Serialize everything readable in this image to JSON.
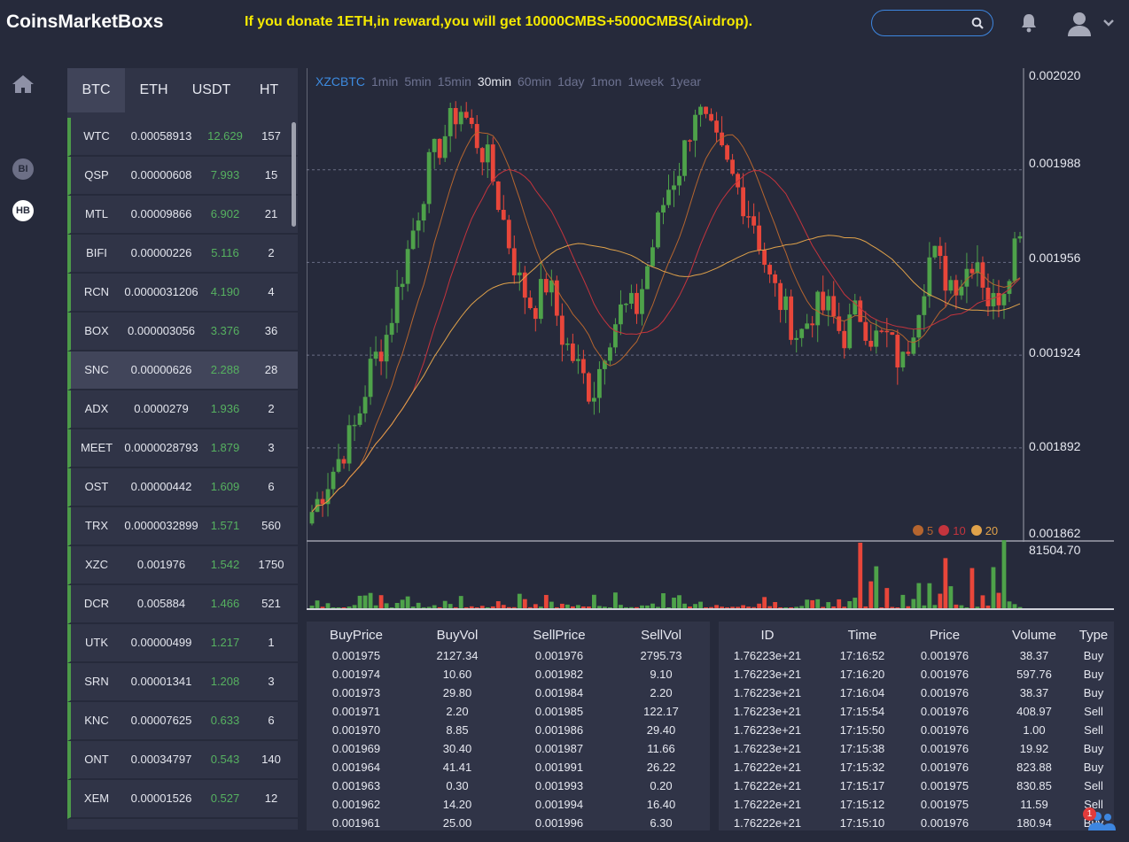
{
  "header": {
    "logo": "CoinsMarketBoxs",
    "promo": "If you donate 1ETH,in reward,you will get 10000CMBS+5000CMBS(Airdrop).",
    "search_placeholder": ""
  },
  "sidenav": {
    "items": [
      "home-icon",
      "BI",
      "HB"
    ]
  },
  "market_tabs": [
    "BTC",
    "ETH",
    "USDT",
    "HT"
  ],
  "active_market_tab": "BTC",
  "markets": [
    {
      "symbol": "WTC",
      "price": "0.00058913",
      "change": "12.629",
      "volume": "157"
    },
    {
      "symbol": "QSP",
      "price": "0.00000608",
      "change": "7.993",
      "volume": "15"
    },
    {
      "symbol": "MTL",
      "price": "0.00009866",
      "change": "6.902",
      "volume": "21"
    },
    {
      "symbol": "BIFI",
      "price": "0.00000226",
      "change": "5.116",
      "volume": "2"
    },
    {
      "symbol": "RCN",
      "price": "0.0000031206",
      "change": "4.190",
      "volume": "4"
    },
    {
      "symbol": "BOX",
      "price": "0.000003056",
      "change": "3.376",
      "volume": "36"
    },
    {
      "symbol": "SNC",
      "price": "0.00000626",
      "change": "2.288",
      "volume": "28"
    },
    {
      "symbol": "ADX",
      "price": "0.0000279",
      "change": "1.936",
      "volume": "2"
    },
    {
      "symbol": "MEET",
      "price": "0.0000028793",
      "change": "1.879",
      "volume": "3"
    },
    {
      "symbol": "OST",
      "price": "0.00000442",
      "change": "1.609",
      "volume": "6"
    },
    {
      "symbol": "TRX",
      "price": "0.0000032899",
      "change": "1.571",
      "volume": "560"
    },
    {
      "symbol": "XZC",
      "price": "0.001976",
      "change": "1.542",
      "volume": "1750"
    },
    {
      "symbol": "DCR",
      "price": "0.005884",
      "change": "1.466",
      "volume": "521"
    },
    {
      "symbol": "UTK",
      "price": "0.00000499",
      "change": "1.217",
      "volume": "1"
    },
    {
      "symbol": "SRN",
      "price": "0.00001341",
      "change": "1.208",
      "volume": "3"
    },
    {
      "symbol": "KNC",
      "price": "0.00007625",
      "change": "0.633",
      "volume": "6"
    },
    {
      "symbol": "ONT",
      "price": "0.00034797",
      "change": "0.543",
      "volume": "140"
    },
    {
      "symbol": "XEM",
      "price": "0.00001526",
      "change": "0.527",
      "volume": "12"
    }
  ],
  "selected_market": "SNC",
  "chart": {
    "symbol": "XZCBTC",
    "periods": [
      "1min",
      "5min",
      "15min",
      "30min",
      "60min",
      "1day",
      "1mon",
      "1week",
      "1year"
    ],
    "active_period": "30min",
    "y_ticks": [
      "0.002020",
      "0.001988",
      "0.001956",
      "0.001924",
      "0.001892",
      "0.001862"
    ],
    "volume_max": "81504.70",
    "ma_legend": [
      {
        "label": "5",
        "color": "#b5652f"
      },
      {
        "label": "10",
        "color": "#c4343d"
      },
      {
        "label": "20",
        "color": "#e0a24a"
      }
    ],
    "colors": {
      "up": "#4ea24a",
      "down": "#e8463a",
      "ma5": "#b5652f",
      "ma10": "#c4343d",
      "ma20": "#e0a24a"
    }
  },
  "chart_data": {
    "type": "candlestick",
    "ylim": [
      0.001862,
      0.00202
    ],
    "y_ticks": [
      0.00202,
      0.001988,
      0.001956,
      0.001924,
      0.001892,
      0.001862
    ],
    "series_close": [
      0.00187,
      0.00188,
      0.00189,
      0.0019,
      0.00192,
      0.00193,
      0.00195,
      0.00197,
      0.00199,
      0.002,
      0.00201,
      0.002,
      0.00199,
      0.00197,
      0.00195,
      0.00194,
      0.00195,
      0.00193,
      0.00192,
      0.00191,
      0.00193,
      0.00194,
      0.00194,
      0.00196,
      0.00198,
      0.00199,
      0.00201,
      0.002,
      0.00199,
      0.00198,
      0.00197,
      0.00195,
      0.00194,
      0.00193,
      0.00194,
      0.00194,
      0.00193,
      0.00194,
      0.00193,
      0.00193,
      0.00192,
      0.00194,
      0.00196,
      0.00195,
      0.00195,
      0.00196,
      0.00194,
      0.00195,
      0.00197
    ],
    "ma_series": [
      "5",
      "10",
      "20"
    ]
  },
  "orderbook": {
    "headers": [
      "BuyPrice",
      "BuyVol",
      "SellPrice",
      "SellVol"
    ],
    "rows": [
      [
        "0.001975",
        "2127.34",
        "0.001976",
        "2795.73"
      ],
      [
        "0.001974",
        "10.60",
        "0.001982",
        "9.10"
      ],
      [
        "0.001973",
        "29.80",
        "0.001984",
        "2.20"
      ],
      [
        "0.001971",
        "2.20",
        "0.001985",
        "122.17"
      ],
      [
        "0.001970",
        "8.85",
        "0.001986",
        "29.40"
      ],
      [
        "0.001969",
        "30.40",
        "0.001987",
        "11.66"
      ],
      [
        "0.001964",
        "41.41",
        "0.001991",
        "26.22"
      ],
      [
        "0.001963",
        "0.30",
        "0.001993",
        "0.20"
      ],
      [
        "0.001962",
        "14.20",
        "0.001994",
        "16.40"
      ],
      [
        "0.001961",
        "25.00",
        "0.001996",
        "6.30"
      ]
    ]
  },
  "trades": {
    "headers": [
      "ID",
      "Time",
      "Price",
      "Volume",
      "Type"
    ],
    "rows": [
      [
        "1.76223e+21",
        "17:16:52",
        "0.001976",
        "38.37",
        "Buy"
      ],
      [
        "1.76223e+21",
        "17:16:20",
        "0.001976",
        "597.76",
        "Buy"
      ],
      [
        "1.76223e+21",
        "17:16:04",
        "0.001976",
        "38.37",
        "Buy"
      ],
      [
        "1.76223e+21",
        "17:15:54",
        "0.001976",
        "408.97",
        "Sell"
      ],
      [
        "1.76223e+21",
        "17:15:50",
        "0.001976",
        "1.00",
        "Sell"
      ],
      [
        "1.76223e+21",
        "17:15:38",
        "0.001976",
        "19.92",
        "Buy"
      ],
      [
        "1.76222e+21",
        "17:15:32",
        "0.001976",
        "823.88",
        "Buy"
      ],
      [
        "1.76222e+21",
        "17:15:17",
        "0.001975",
        "830.85",
        "Sell"
      ],
      [
        "1.76222e+21",
        "17:15:12",
        "0.001975",
        "11.59",
        "Sell"
      ],
      [
        "1.76222e+21",
        "17:15:10",
        "0.001976",
        "180.94",
        "Buy"
      ]
    ]
  },
  "notification_count": "1"
}
